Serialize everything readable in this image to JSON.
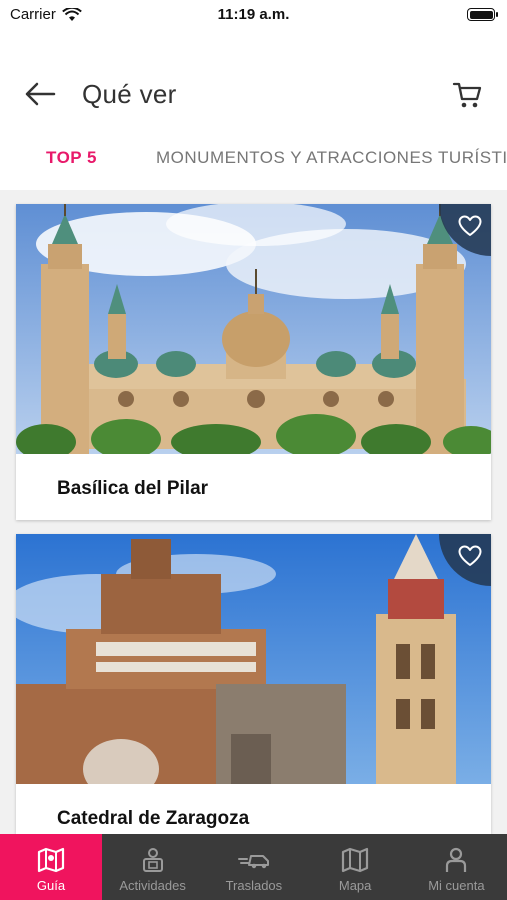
{
  "status_bar": {
    "carrier": "Carrier",
    "time": "11:19 a.m."
  },
  "header": {
    "title": "Qué ver"
  },
  "tabs": [
    {
      "label": "TOP 5"
    },
    {
      "label": "MONUMENTOS Y ATRACCIONES TURÍSTICAS"
    }
  ],
  "cards": [
    {
      "name": "Basílica del Pilar"
    },
    {
      "name": "Catedral de Zaragoza"
    }
  ],
  "bottom_nav": [
    {
      "label": "Guía",
      "icon": "map-icon"
    },
    {
      "label": "Actividades",
      "icon": "person-ticket-icon"
    },
    {
      "label": "Traslados",
      "icon": "car-icon"
    },
    {
      "label": "Mapa",
      "icon": "folded-map-icon"
    },
    {
      "label": "Mi cuenta",
      "icon": "user-icon"
    }
  ],
  "colors": {
    "accent": "#e8196a",
    "nav_active": "#f0145e",
    "nav_bg": "#3a3a3a",
    "fav_bg": "#233750"
  }
}
